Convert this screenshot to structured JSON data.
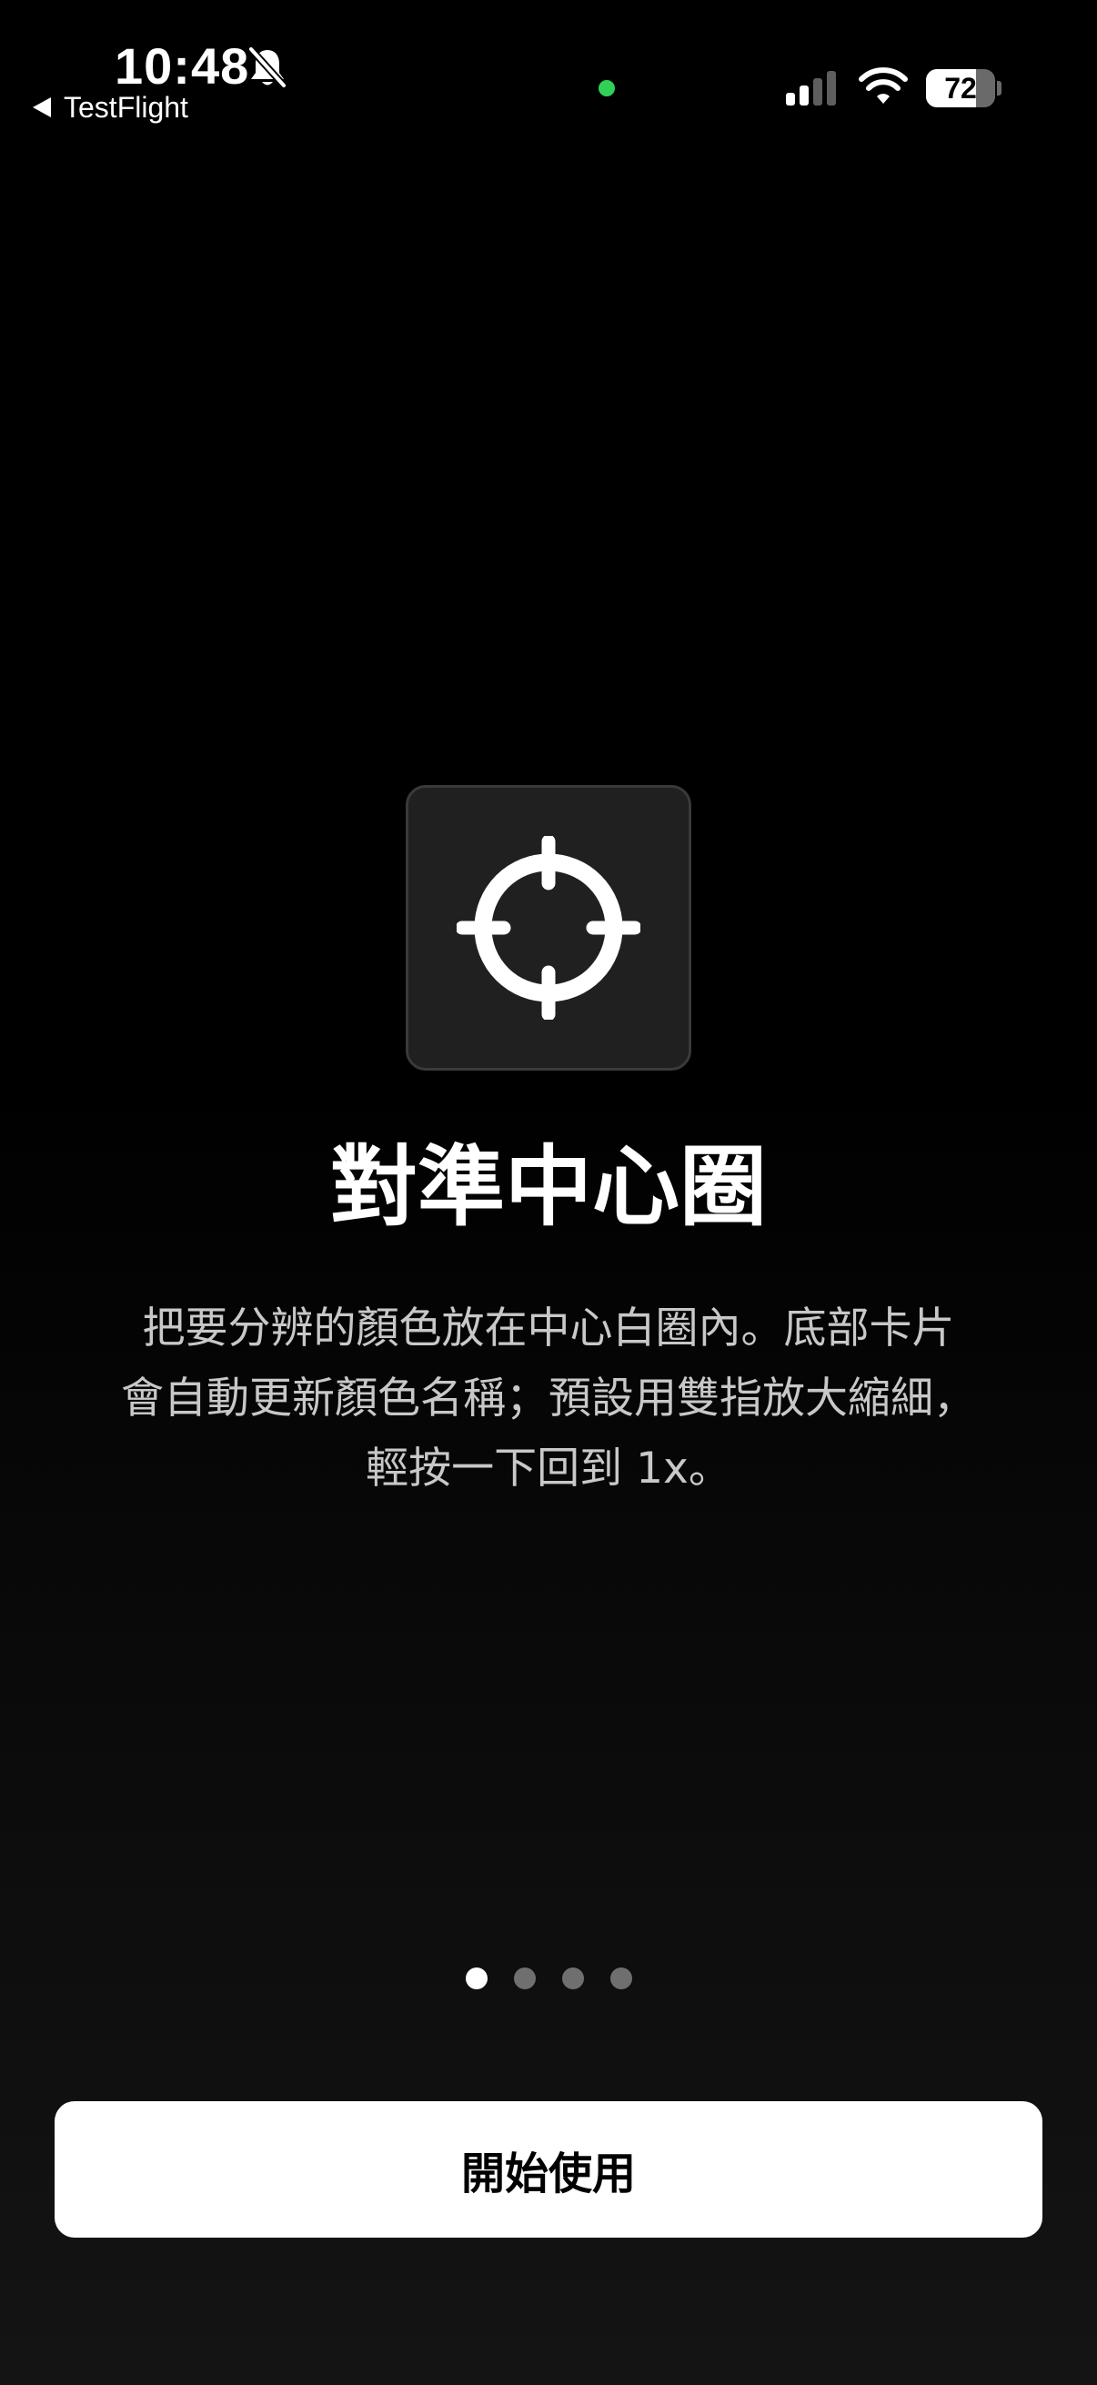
{
  "status_bar": {
    "time": "10:48",
    "back_label": "TestFlight",
    "battery_level": "72",
    "battery_fraction": 0.72,
    "privacy_indicator_color": "#31d158",
    "icons": [
      "bell-slash-icon",
      "cellular-signal-icon",
      "wifi-icon",
      "battery-icon"
    ]
  },
  "onboarding": {
    "icon": "crosshair-icon",
    "title": "對準中心圈",
    "description": "把要分辨的顏色放在中心白圈內。底部卡片\n會自動更新顏色名稱；預設用雙指放大縮細，\n輕按一下回到 1x。",
    "page_count": 4,
    "current_page": 1,
    "start_button_label": "開始使用"
  },
  "colors": {
    "background": "#000000",
    "title": "#ffffff",
    "description": "#c8c8c8",
    "tile_background": "#202020",
    "button_background": "#ffffff",
    "button_text": "#000000"
  }
}
